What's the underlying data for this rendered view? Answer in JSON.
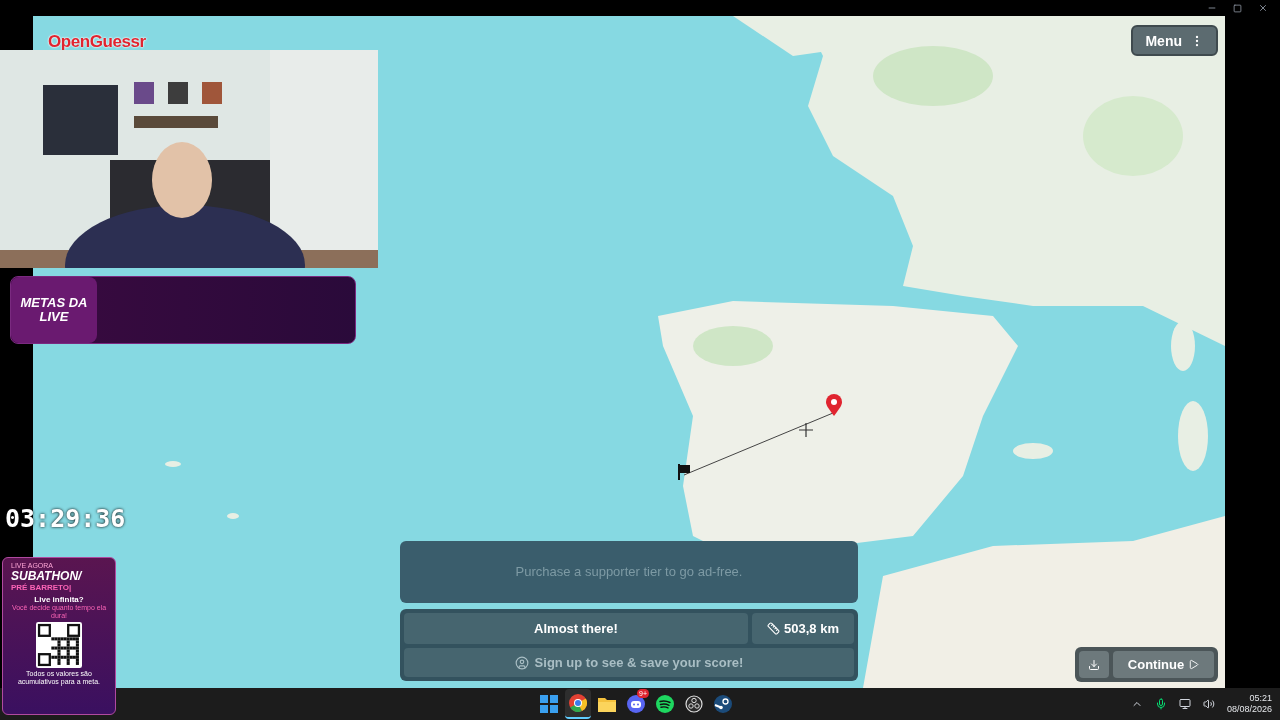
{
  "game": {
    "logo": "OpenGuessr",
    "menu_button": "Menu",
    "ad_notice": "Purchase a supporter tier to go ad-free.",
    "result": {
      "message": "Almost there!",
      "distance": "503,8 km"
    },
    "signup_button": "Sign up to see & save your score!",
    "continue_button": "Continue"
  },
  "stream_overlay": {
    "goals_title": "METAS DA LIVE",
    "timer": "03:29:36",
    "promo": {
      "tag": "LIVE AGORA",
      "title": "SUBATHON/",
      "subtitle": "PRÉ BARRETO|",
      "question": "Live infinita?",
      "description": "Você decide quanto tempo ela dura!",
      "footnote": "Todos os valores são acumulativos para a meta."
    }
  },
  "taskbar": {
    "apps": [
      {
        "kind": "start",
        "selected": false
      },
      {
        "kind": "browser",
        "selected": true
      },
      {
        "kind": "folder",
        "selected": false
      },
      {
        "kind": "chat",
        "selected": false,
        "badge": "9+"
      },
      {
        "kind": "music",
        "selected": false
      },
      {
        "kind": "recorder",
        "selected": false
      },
      {
        "kind": "games",
        "selected": false
      }
    ],
    "time": "05:21",
    "date": "08/08/2026"
  }
}
